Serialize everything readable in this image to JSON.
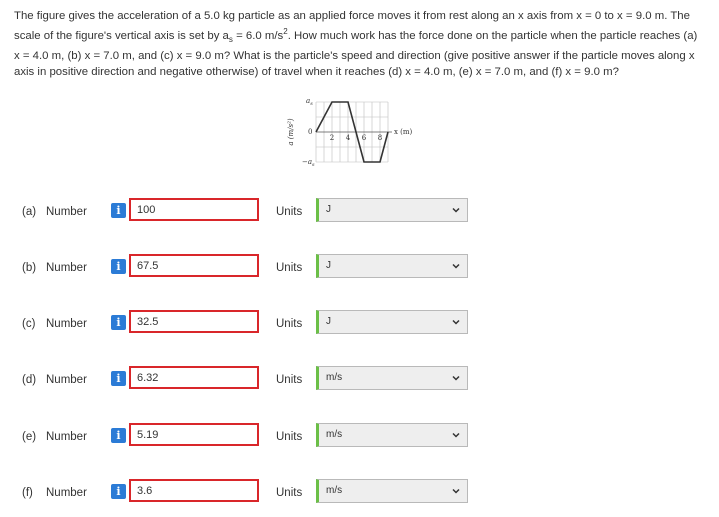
{
  "question": {
    "line1": "The figure gives the acceleration of a 5.0 kg particle as an applied force moves it from rest along an x axis from x = 0 to x = 9.0 m. The",
    "line2_a": "scale of the figure's vertical axis is set by a",
    "line2_sub": "s",
    "line2_b": " = 6.0 m/s",
    "line2_sup": "2",
    "line2_c": ". How much work has the force done on the particle when the particle reaches (a)",
    "line3": "x = 4.0 m, (b) x = 7.0 m, and (c) x = 9.0 m? What is the particle's speed and direction (give positive answer if the particle moves along x",
    "line4": "axis in positive direction and negative otherwise) of travel when it reaches (d) x = 4.0 m, (e) x = 7.0 m, and (f) x = 9.0 m?"
  },
  "figure": {
    "y_label": "a (m/s²)",
    "y_top": "a",
    "y_top_sub": "s",
    "y_zero": "0",
    "y_bottom": "−a",
    "y_bottom_sub": "s",
    "x_ticks": [
      "2",
      "4",
      "6",
      "8"
    ],
    "x_label": "x (m)"
  },
  "common": {
    "number_label": "Number",
    "units_label": "Units",
    "info_glyph": "i"
  },
  "rows": [
    {
      "part": "(a)",
      "value": "100",
      "unit": "J"
    },
    {
      "part": "(b)",
      "value": "67.5",
      "unit": "J"
    },
    {
      "part": "(c)",
      "value": "32.5",
      "unit": "J"
    },
    {
      "part": "(d)",
      "value": "6.32",
      "unit": "m/s"
    },
    {
      "part": "(e)",
      "value": "5.19",
      "unit": "m/s"
    },
    {
      "part": "(f)",
      "value": "3.6",
      "unit": "m/s"
    }
  ],
  "colors": {
    "info_blue": "#2b7bd6",
    "error_red": "#d9262a",
    "select_green": "#6bbf47"
  }
}
